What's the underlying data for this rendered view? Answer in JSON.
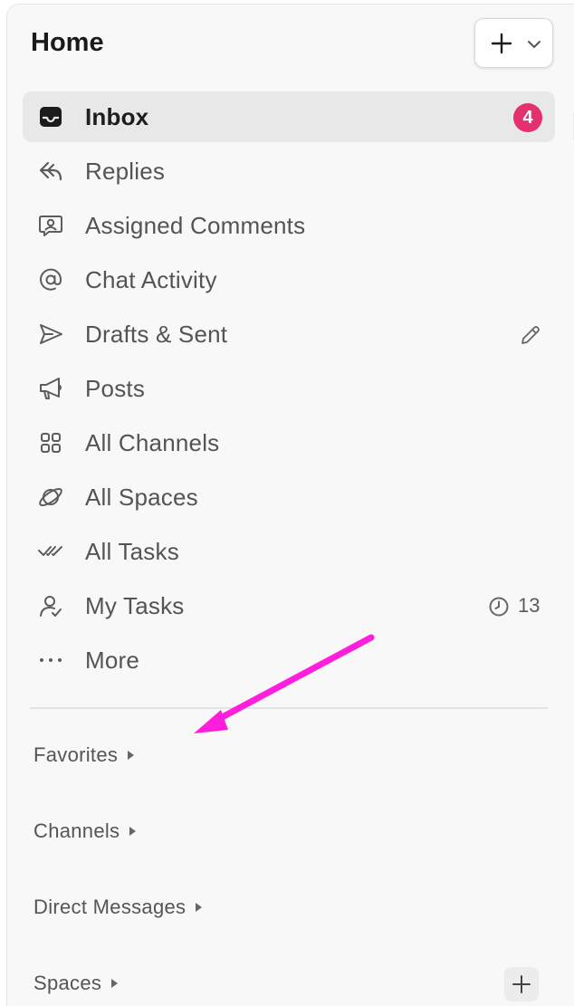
{
  "header": {
    "title": "Home",
    "new_button_icon": "plus-icon",
    "new_dropdown_icon": "chevron-down-icon"
  },
  "nav": {
    "items": [
      {
        "label": "Inbox",
        "icon": "inbox-icon",
        "active": true,
        "badge": "4"
      },
      {
        "label": "Replies",
        "icon": "reply-icon"
      },
      {
        "label": "Assigned Comments",
        "icon": "assigned-comment-icon"
      },
      {
        "label": "Chat Activity",
        "icon": "at-sign-icon"
      },
      {
        "label": "Drafts & Sent",
        "icon": "send-icon",
        "action_icon": "pencil-icon"
      },
      {
        "label": "Posts",
        "icon": "megaphone-icon"
      },
      {
        "label": "All Channels",
        "icon": "grid-icon"
      },
      {
        "label": "All Spaces",
        "icon": "planet-icon"
      },
      {
        "label": "All Tasks",
        "icon": "double-check-icon"
      },
      {
        "label": "My Tasks",
        "icon": "user-check-icon",
        "meta_icon": "clock-icon",
        "meta_count": "13"
      },
      {
        "label": "More",
        "icon": "more-dots-icon"
      }
    ]
  },
  "sections": {
    "favorites": "Favorites",
    "channels": "Channels",
    "direct_messages": "Direct Messages",
    "spaces": "Spaces"
  },
  "colors": {
    "badge": "#e4306e",
    "annotation_arrow": "#ff1edb",
    "active_row": "#e8e8e8",
    "panel_bg": "#f8f8f8"
  }
}
